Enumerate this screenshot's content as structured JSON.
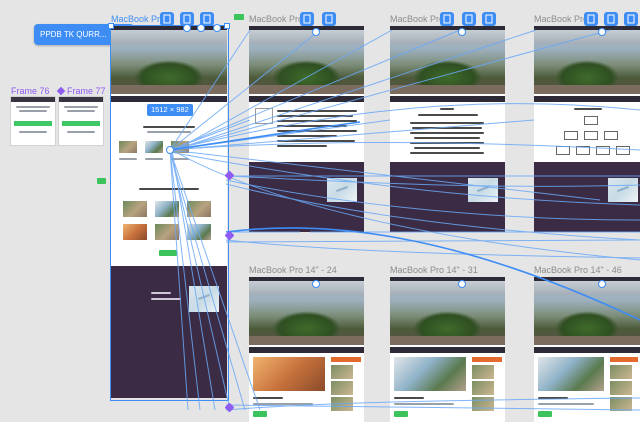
{
  "canvas": {
    "background": "#e5e5e5",
    "accent": "#3d8df5",
    "prototype_color": "#8e5cf0"
  },
  "floating_frame": {
    "name": "PPDB TK QURR...",
    "icon": "frame-link-icon"
  },
  "frames": {
    "frame76": "Frame 76",
    "frame77": "Frame 77",
    "top": [
      {
        "label": "MacBook Pro 1"
      },
      {
        "label": "MacBook Pro 1"
      },
      {
        "label": "MacBook Pro 1"
      },
      {
        "label": "MacBook Pro 1"
      }
    ],
    "bottom": [
      {
        "label": "MacBook Pro 14\" - 24"
      },
      {
        "label": "MacBook Pro 14\" - 31"
      },
      {
        "label": "MacBook Pro 14\" - 46"
      }
    ]
  },
  "selection": {
    "dimensions": "1512 × 982"
  },
  "toolbar_icons": [
    "component-icon",
    "component-icon",
    "component-icon",
    "component-icon"
  ],
  "content": {
    "page2_quote": "\"Pada tahun 1991 (Bismillah telah berdiri yang sejarahnya\"",
    "page3_heading": "Misi",
    "page4_chart": "org-chart"
  }
}
